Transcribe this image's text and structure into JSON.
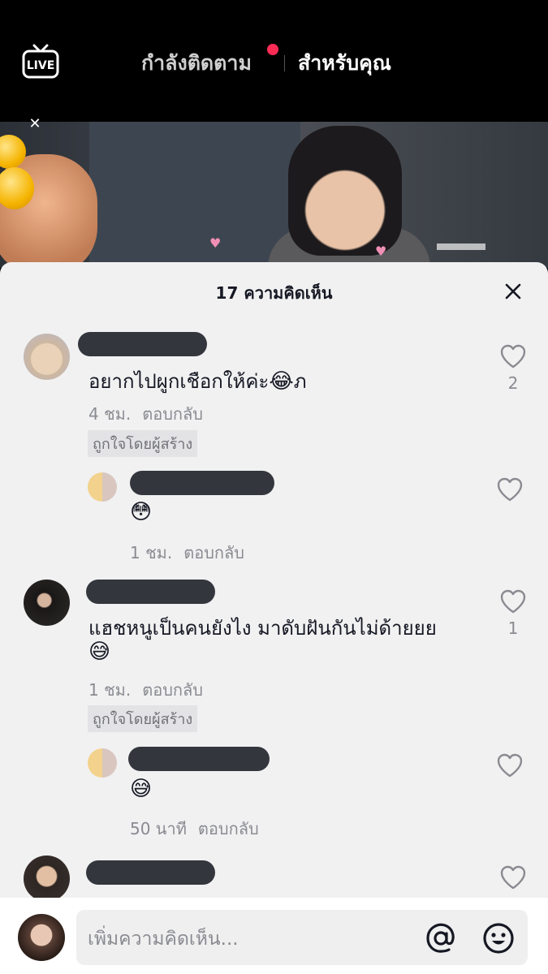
{
  "top": {
    "live_label": "LIVE",
    "tab_following": "กำลังติดตาม",
    "tab_for_you": "สำหรับคุณ"
  },
  "sheet": {
    "title": "17 ความคิดเห็น",
    "comments": [
      {
        "text": "อยากไปผูกเชือกให้ค่ะ",
        "emoji": "😂",
        "trailing": "ภ",
        "time": "4 ชม.",
        "reply_label": "ตอบกลับ",
        "creator_tag": "ถูกใจโดยผู้สร้าง",
        "likes": "2"
      },
      {
        "emoji": "😳",
        "time": "1 ชม.",
        "reply_label": "ตอบกลับ"
      },
      {
        "text": "แฮชหนูเป็นคนยังไง มาดับฝันกันไม่ด้ายยย",
        "emoji": "😅",
        "time": "1 ชม.",
        "reply_label": "ตอบกลับ",
        "creator_tag": "ถูกใจโดยผู้สร้าง",
        "likes": "1"
      },
      {
        "emoji": "😅",
        "time": "50 นาที",
        "reply_label": "ตอบกลับ"
      }
    ]
  },
  "input": {
    "placeholder": "เพิ่มความคิดเห็น..."
  },
  "icons": {
    "live": "live-tv-icon",
    "close": "close-icon",
    "heart": "heart-outline-icon",
    "at": "at-mention-icon",
    "emoji": "emoji-icon"
  },
  "colors": {
    "accent_red": "#fe2c55",
    "sheet_bg": "#f1f1f2",
    "text": "#161823",
    "muted": "#8a8b91"
  }
}
